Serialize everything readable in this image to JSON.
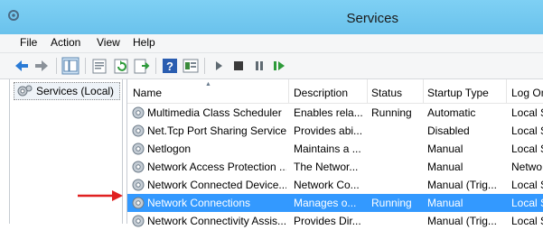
{
  "window": {
    "title": "Services",
    "accent": "#74c9f0"
  },
  "menu": {
    "items": [
      "File",
      "Action",
      "View",
      "Help"
    ]
  },
  "toolbar": {
    "icons": [
      "back-icon",
      "forward-icon",
      "show-hide-console-tree-icon",
      "properties-icon",
      "refresh-icon",
      "export-list-icon",
      "help-icon",
      "view-icon",
      "start-icon",
      "stop-icon",
      "pause-icon",
      "restart-icon"
    ]
  },
  "tree": {
    "root_label": "Services (Local)"
  },
  "table": {
    "columns": [
      "Name",
      "Description",
      "Status",
      "Startup Type",
      "Log On As"
    ],
    "rows": [
      {
        "name": "Multimedia Class Scheduler",
        "description": "Enables rela...",
        "status": "Running",
        "startup": "Automatic",
        "logon": "Local Sy"
      },
      {
        "name": "Net.Tcp Port Sharing Service",
        "description": "Provides abi...",
        "status": "",
        "startup": "Disabled",
        "logon": "Local Se"
      },
      {
        "name": "Netlogon",
        "description": "Maintains a ...",
        "status": "",
        "startup": "Manual",
        "logon": "Local Sy"
      },
      {
        "name": "Network Access Protection ...",
        "description": "The Networ...",
        "status": "",
        "startup": "Manual",
        "logon": "Netwo"
      },
      {
        "name": "Network Connected Device...",
        "description": "Network Co...",
        "status": "",
        "startup": "Manual (Trig...",
        "logon": "Local Se"
      },
      {
        "name": "Network Connections",
        "description": "Manages o...",
        "status": "Running",
        "startup": "Manual",
        "logon": "Local Sy"
      },
      {
        "name": "Network Connectivity Assis...",
        "description": "Provides Dir...",
        "status": "",
        "startup": "Manual (Trig...",
        "logon": "Local Sy"
      }
    ],
    "selected_index": 5,
    "selection_color": "#3399ff"
  },
  "annotation": {
    "arrow_color": "#e02020"
  }
}
